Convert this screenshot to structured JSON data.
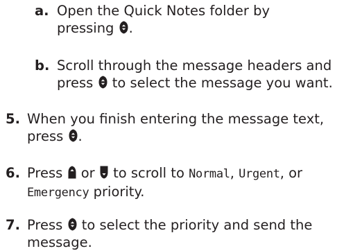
{
  "substeps": [
    {
      "marker": "a.",
      "lines": [
        "Open the Quick Notes folder by",
        "pressing",
        "."
      ],
      "icons": [
        "select-key-icon"
      ]
    },
    {
      "marker": "b.",
      "lines": [
        "Scroll through the message headers and",
        "press",
        "to select the message you want."
      ],
      "icons": [
        "select-key-icon"
      ]
    }
  ],
  "steps": [
    {
      "marker": "5.",
      "lines": [
        "When you finish entering the message text,",
        "press",
        "."
      ],
      "icons": [
        "select-key-icon"
      ]
    },
    {
      "marker": "6.",
      "text_parts": [
        "Press",
        "or",
        "to scroll to",
        "Normal",
        ",",
        "Urgent",
        ", or",
        "Emergency",
        "priority."
      ],
      "icons": [
        "scroll-up-key-icon",
        "scroll-down-key-icon"
      ]
    },
    {
      "marker": "7.",
      "lines": [
        "Press",
        "to select the priority and send the",
        "message."
      ],
      "icons": [
        "select-key-icon"
      ]
    }
  ]
}
